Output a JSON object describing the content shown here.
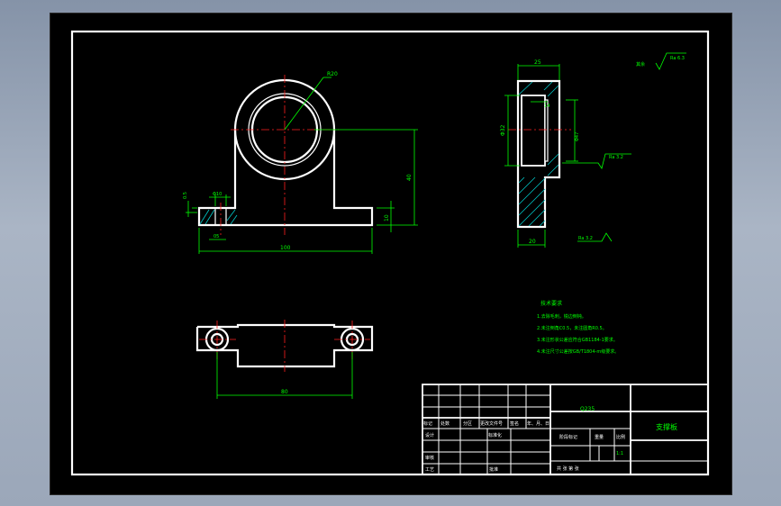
{
  "dims": {
    "r20": "R20",
    "len_25": "25",
    "len_14": "14",
    "phi32": "Φ32",
    "phi47": "Φ47",
    "phi10": "Φ10",
    "len_05": "0.5",
    "len_05b": "05",
    "len_40": "40",
    "len_10": "10",
    "len_100": "100",
    "len_20": "20",
    "len_80": "80"
  },
  "roughness": {
    "general_label": "其余",
    "general_value": "Ra 6.3",
    "bore": "Ra 3.2",
    "base": "Ra 3.2"
  },
  "notes": {
    "title": "技术要求",
    "items": [
      "1.去除毛刺，锐边倒钝。",
      "2.未注倒角C0.5，未注圆角R0.5。",
      "3.未注形状公差应符合GB1184-1要求。",
      "4.未注尺寸公差按GB/T1804-m级要求。"
    ]
  },
  "title_block": {
    "material": "Q235",
    "part_name": "支撑板",
    "scale": "1:1",
    "rev_headers": [
      "标记",
      "处数",
      "分区",
      "更改文件号",
      "签名",
      "年、月、日"
    ],
    "design": "设计",
    "standardize": "标准化",
    "check": "审核",
    "process": "工艺",
    "approve": "批准",
    "stage_mark": "阶段标记",
    "weight": "重量",
    "scale_label": "比例",
    "sheet_info": "共    张    第    张"
  }
}
